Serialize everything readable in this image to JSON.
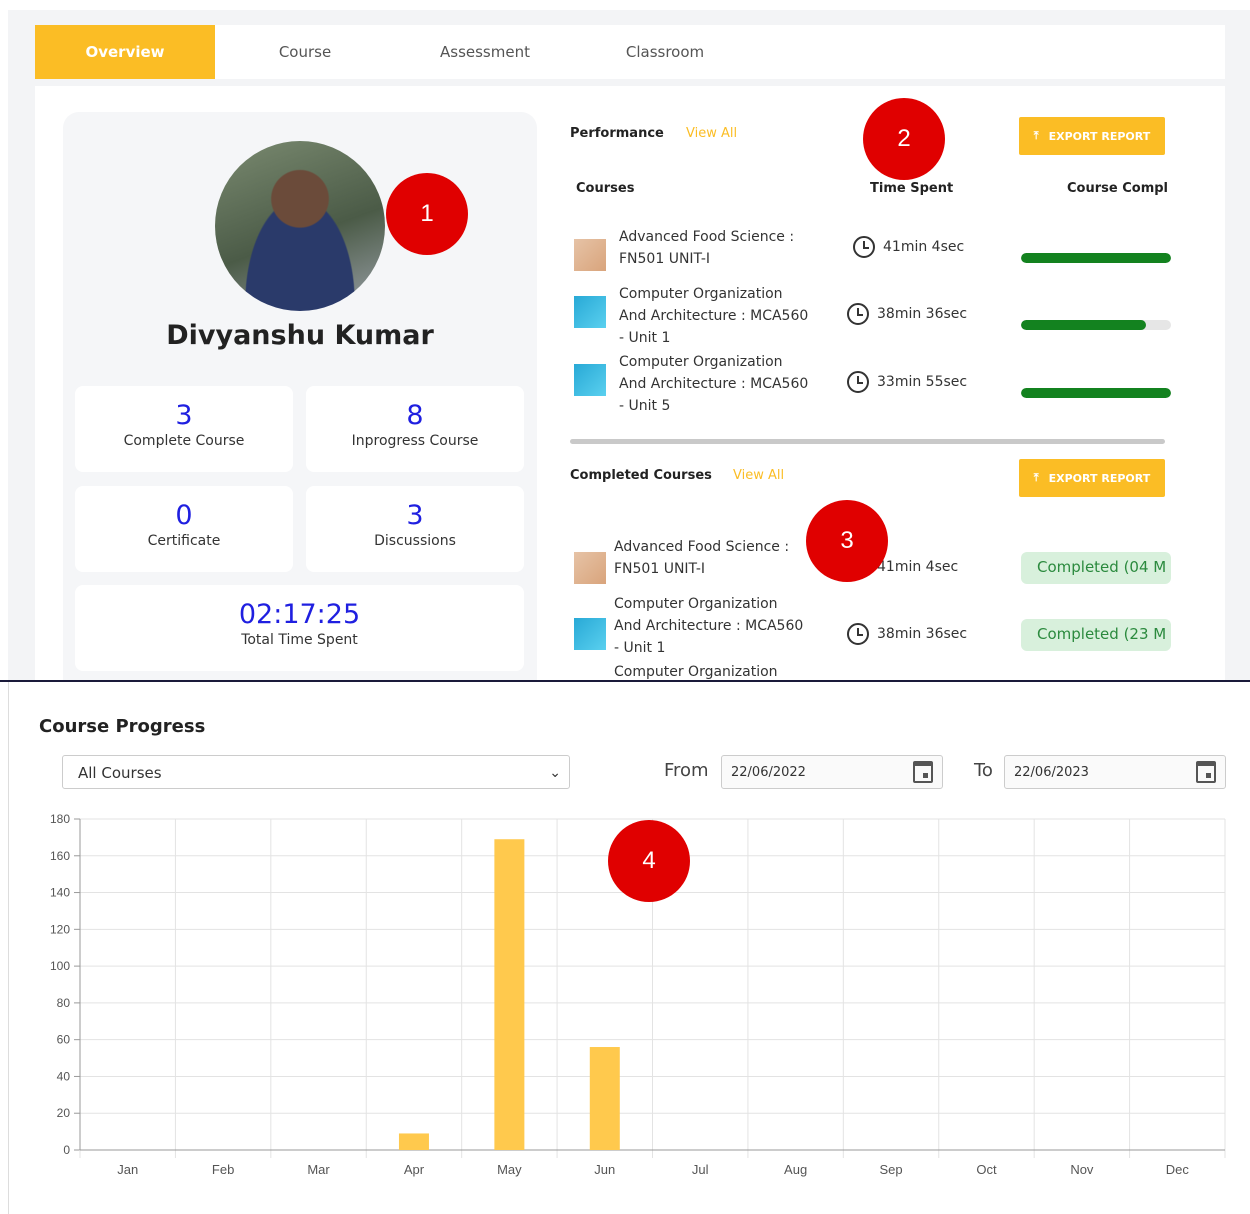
{
  "tabs": [
    {
      "label": "Overview",
      "active": true
    },
    {
      "label": "Course"
    },
    {
      "label": "Assessment"
    },
    {
      "label": "Classroom"
    }
  ],
  "profile": {
    "name": "Divyanshu Kumar",
    "stats": [
      {
        "value": "3",
        "label": "Complete Course"
      },
      {
        "value": "8",
        "label": "Inprogress Course"
      },
      {
        "value": "0",
        "label": "Certificate"
      },
      {
        "value": "3",
        "label": "Discussions"
      }
    ],
    "total_time": {
      "value": "02:17:25",
      "label": "Total Time Spent"
    }
  },
  "performance": {
    "title": "Performance",
    "view_all": "View All",
    "export": "EXPORT REPORT",
    "columns": [
      "Courses",
      "Time Spent",
      "Course Compl"
    ],
    "rows": [
      {
        "name": "Advanced Food Science : FN501 UNIT-I",
        "time": "41min 4sec",
        "progress": 1.0,
        "thumb": "food"
      },
      {
        "name": "Computer Organization And Architecture : MCA560 - Unit 1",
        "time": "38min 36sec",
        "progress": 0.83,
        "thumb": "comp"
      },
      {
        "name": "Computer Organization And Architecture : MCA560 - Unit 5",
        "time": "33min 55sec",
        "progress": 1.0,
        "thumb": "comp"
      }
    ]
  },
  "completed": {
    "title": "Completed Courses",
    "view_all": "View All",
    "export": "EXPORT REPORT",
    "rows": [
      {
        "name": "Advanced Food Science : FN501 UNIT-I",
        "time": "41min 4sec",
        "status": "Completed (04 M",
        "thumb": "food"
      },
      {
        "name": "Computer Organization And Architecture : MCA560 - Unit 1",
        "time": "38min 36sec",
        "status": "Completed (23 M",
        "thumb": "comp"
      },
      {
        "name": "Computer Organization",
        "thumb": "comp"
      }
    ]
  },
  "markers": [
    "1",
    "2",
    "3",
    "4"
  ],
  "course_progress": {
    "title": "Course Progress",
    "select": "All Courses",
    "from_label": "From",
    "from": "22/06/2022",
    "to_label": "To",
    "to": "22/06/2023"
  },
  "chart_data": {
    "type": "bar",
    "categories": [
      "Jan",
      "Feb",
      "Mar",
      "Apr",
      "May",
      "Jun",
      "Jul",
      "Aug",
      "Sep",
      "Oct",
      "Nov",
      "Dec"
    ],
    "values": [
      0,
      0,
      0,
      9,
      169,
      56,
      0,
      0,
      0,
      0,
      0,
      0
    ],
    "ylim": [
      0,
      180
    ],
    "yticks": [
      0,
      20,
      40,
      60,
      80,
      100,
      120,
      140,
      160,
      180
    ],
    "color": "#ffc94d",
    "grid": true,
    "title": "",
    "xlabel": "",
    "ylabel": ""
  }
}
